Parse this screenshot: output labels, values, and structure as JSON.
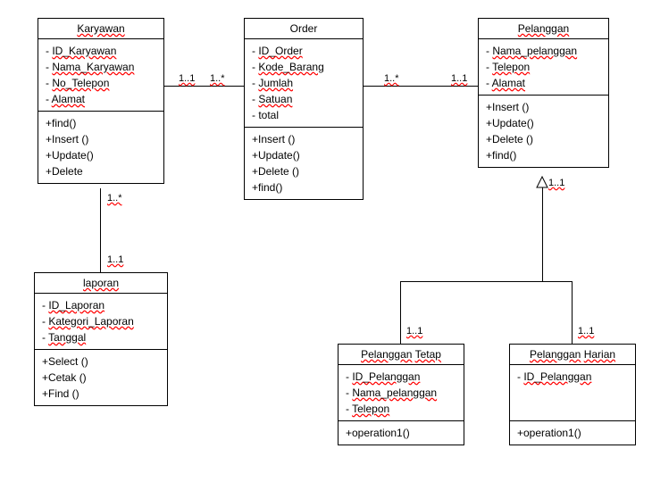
{
  "classes": {
    "karyawan": {
      "name": "Karyawan",
      "attrs": [
        "- ID_Karyawan",
        "- Nama_Karyawan",
        "- No_Telepon",
        "- Alamat"
      ],
      "ops": [
        "+find()",
        "+Insert ()",
        "+Update()",
        "+Delete"
      ]
    },
    "order": {
      "name": "Order",
      "attrs": [
        "- ID_Order",
        "- Kode_Barang",
        "- Jumlah",
        "- Satuan",
        "- total"
      ],
      "ops": [
        "+Insert ()",
        "+Update()",
        "+Delete ()",
        "+find()"
      ]
    },
    "pelanggan": {
      "name": "Pelanggan",
      "attrs": [
        "- Nama_pelanggan",
        "- Telepon",
        "- Alamat"
      ],
      "ops": [
        "+Insert ()",
        "+Update()",
        "+Delete ()",
        "+find()"
      ]
    },
    "laporan": {
      "name": "laporan",
      "attrs": [
        "- ID_Laporan",
        "- Kategori_Laporan",
        "- Tanggal"
      ],
      "ops": [
        "+Select ()",
        "+Cetak ()",
        "+Find ()"
      ]
    },
    "tetap": {
      "name": "Pelanggan Tetap",
      "attrs": [
        "- ID_Pelanggan",
        "- Nama_pelanggan",
        "- Telepon"
      ],
      "ops": [
        "+operation1()"
      ]
    },
    "harian": {
      "name": "Pelanggan Harian",
      "attrs": [
        "- ID_Pelanggan"
      ],
      "ops": [
        "+operation1()"
      ]
    }
  },
  "mult": {
    "k_o_left": "1..1",
    "k_o_right": "1..*",
    "o_p_left": "1..*",
    "o_p_right": "1..1",
    "k_l_top": "1..*",
    "k_l_bottom": "1..1",
    "p_child": "1..1",
    "tetap": "1..1",
    "harian": "1..1"
  }
}
